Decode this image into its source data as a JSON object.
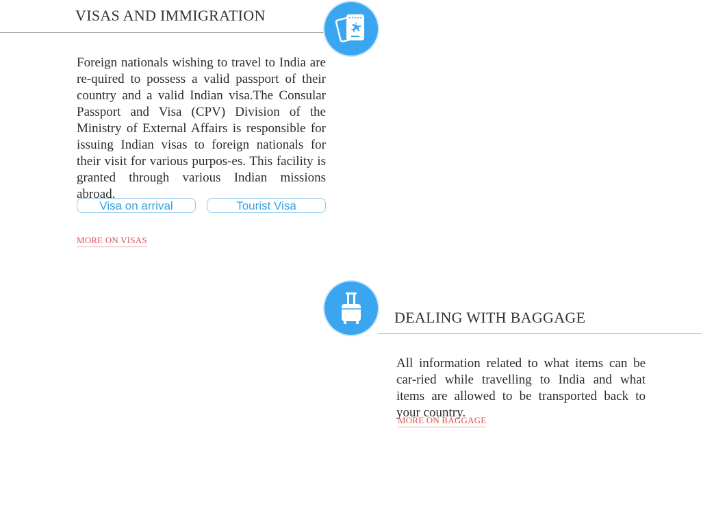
{
  "visas": {
    "title": "VISAS AND IMMIGRATION",
    "icon": "passport-plane-icon",
    "body": "Foreign nationals wishing to travel to India are re-quired to possess a valid passport of their country and a valid Indian visa.The Consular Passport and Visa (CPV) Division of the Ministry of External Affairs is responsible for issuing Indian visas to foreign nationals for their visit for various purpos-es. This facility is granted through various Indian missions abroad.",
    "buttons": [
      "Visa on arrival",
      "Tourist Visa"
    ],
    "more_link": "MORE ON VISAS"
  },
  "baggage": {
    "title": "DEALING WITH BAGGAGE",
    "icon": "luggage-icon",
    "body": "All information related to what items can be car-ried while travelling to India and what items are allowed to be transported back to your country.",
    "more_link": "MORE ON BAGGAGE"
  },
  "colors": {
    "icon_bg": "#3aa6f0",
    "pill_border": "#8ec9f2",
    "pill_text": "#3a9ee0",
    "link": "#d9534f",
    "rule": "#a8a8a8"
  }
}
